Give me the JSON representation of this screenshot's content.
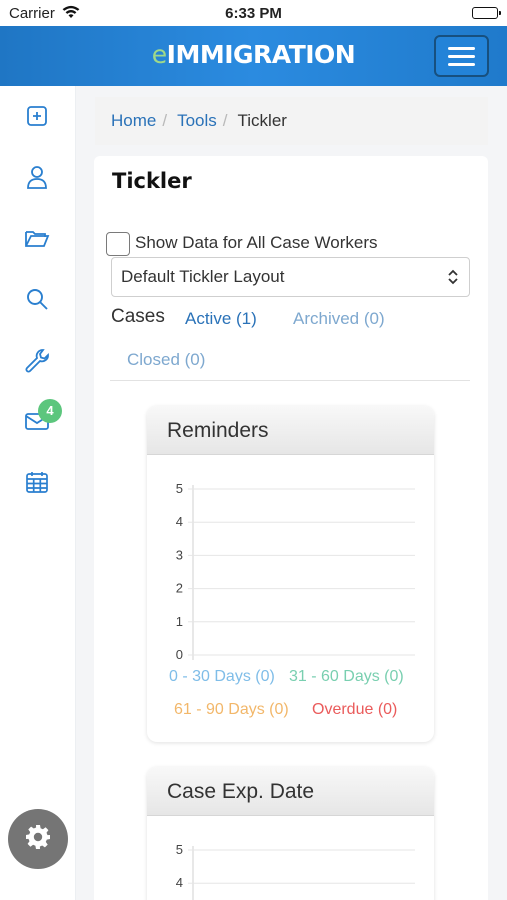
{
  "status_bar": {
    "carrier": "Carrier",
    "time": "6:33 PM"
  },
  "app": {
    "logo_e": "e",
    "logo_rest": "IMMIGRATION"
  },
  "sidebar": {
    "icons": [
      "add-square-icon",
      "user-icon",
      "folder-icon",
      "search-icon",
      "wrench-icon",
      "mail-icon",
      "calendar-icon"
    ],
    "mail_badge": "4"
  },
  "breadcrumb": {
    "home": "Home",
    "sep": "/",
    "tools": "Tools",
    "current": "Tickler"
  },
  "page": {
    "title": "Tickler",
    "checkbox_label": "Show Data for All Case Workers",
    "layout_select": "Default Tickler Layout"
  },
  "cases": {
    "label": "Cases",
    "tabs": [
      "Active (1)",
      "Archived (0)",
      "Closed (0)"
    ]
  },
  "reminders": {
    "title": "Reminders",
    "legend": [
      {
        "label": "0 - 30 Days (0)",
        "color": "#7fbde8"
      },
      {
        "label": "31 - 60 Days (0)",
        "color": "#79cfb0"
      },
      {
        "label": "61 - 90 Days (0)",
        "color": "#f2b76a"
      },
      {
        "label": "Overdue (0)",
        "color": "#ea5b5b"
      }
    ]
  },
  "case_exp": {
    "title": "Case Exp. Date"
  },
  "colors": {
    "brand_blue": "#2a7fcf",
    "link": "#2a72b8",
    "badge_green": "#5cc67d"
  },
  "chart_data": [
    {
      "type": "bar",
      "title": "Reminders",
      "categories": [
        "0 - 30 Days",
        "31 - 60 Days",
        "61 - 90 Days",
        "Overdue"
      ],
      "values": [
        0,
        0,
        0,
        0
      ],
      "ylim": [
        0,
        5
      ],
      "yticks": [
        "0",
        "1",
        "2",
        "3",
        "4",
        "5"
      ],
      "grid": true
    },
    {
      "type": "bar",
      "title": "Case Exp. Date",
      "categories": [],
      "values": [],
      "ylim": [
        0,
        5
      ],
      "yticks": [
        "4",
        "5"
      ],
      "grid": true
    }
  ]
}
